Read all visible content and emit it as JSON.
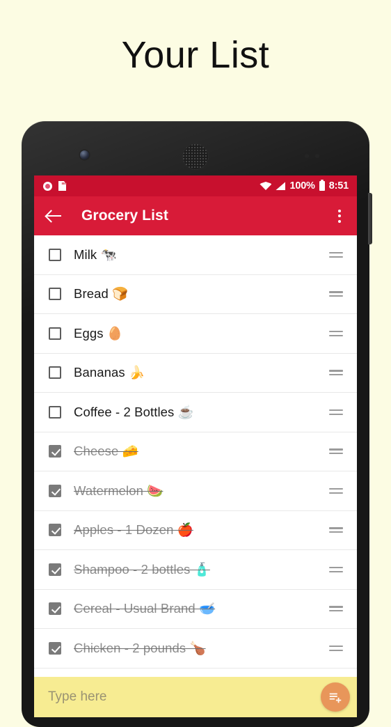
{
  "page": {
    "title": "Your List",
    "background_color": "#FCFCE3"
  },
  "device": {
    "frame_color": "#171717",
    "hardware": {
      "front_camera": "front-camera",
      "earpiece": "earpiece-speaker",
      "side_button": "power-button"
    }
  },
  "status_bar": {
    "background_color": "#C8102E",
    "left_icons": [
      "record-icon",
      "sd-card-icon"
    ],
    "right_icons": [
      "wifi-icon",
      "signal-icon",
      "battery-icon"
    ],
    "battery_label": "100%",
    "clock": "8:51"
  },
  "app_bar": {
    "background_color": "#D81B38",
    "back_icon": "back-arrow-icon",
    "title": "Grocery List",
    "overflow_icon": "overflow-menu-icon"
  },
  "list": {
    "items": [
      {
        "label": "Milk 🐄",
        "checked": false
      },
      {
        "label": "Bread 🍞",
        "checked": false
      },
      {
        "label": "Eggs 🥚",
        "checked": false
      },
      {
        "label": "Bananas 🍌",
        "checked": false
      },
      {
        "label": "Coffee - 2 Bottles ☕",
        "checked": false
      },
      {
        "label": "Cheese 🧀",
        "checked": true
      },
      {
        "label": "Watermelon 🍉",
        "checked": true
      },
      {
        "label": "Apples - 1 Dozen 🍎",
        "checked": true
      },
      {
        "label": "Shampoo - 2 bottles 🧴",
        "checked": true
      },
      {
        "label": "Cereal - Usual Brand 🥣",
        "checked": true
      },
      {
        "label": "Chicken - 2 pounds 🍗",
        "checked": true
      }
    ],
    "drag_handle_icon": "drag-handle-icon"
  },
  "compose": {
    "background_color": "#F7EC92",
    "placeholder": "Type here",
    "value": "",
    "fab_icon": "playlist-add-icon",
    "fab_color": "#E8965A"
  }
}
